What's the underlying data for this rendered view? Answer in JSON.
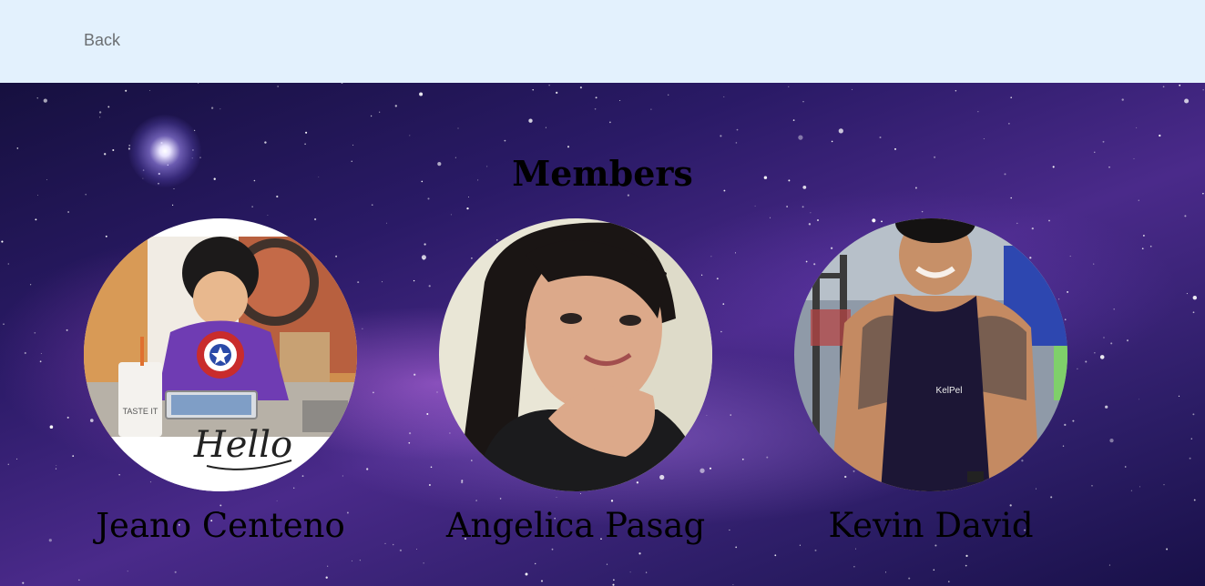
{
  "header": {
    "back_label": "Back"
  },
  "main": {
    "title": "Members",
    "members": [
      {
        "name": "Jeano Centeno",
        "photo_text": "Hello",
        "shirt_text": "TASTE IT"
      },
      {
        "name": "Angelica Pasag"
      },
      {
        "name": "Kevin David",
        "shirt_text": "KelPel"
      }
    ]
  },
  "colors": {
    "header_bg": "#e3f1fd",
    "back_text": "#6b6f72",
    "heading_text": "#000000"
  }
}
